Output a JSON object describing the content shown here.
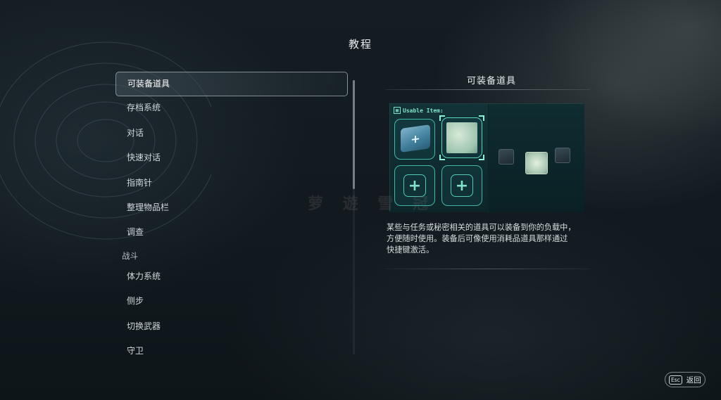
{
  "header": {
    "title": "教程"
  },
  "menu": {
    "items": [
      {
        "label": "可装备道具",
        "selected": true
      },
      {
        "label": "存档系统"
      },
      {
        "label": "对话"
      },
      {
        "label": "快速对话"
      },
      {
        "label": "指南针"
      },
      {
        "label": "整理物品栏"
      },
      {
        "label": "调查"
      }
    ],
    "section": "战斗",
    "section_items": [
      {
        "label": "体力系统"
      },
      {
        "label": "侧步"
      },
      {
        "label": "切换武器"
      },
      {
        "label": "守卫"
      }
    ]
  },
  "detail": {
    "title": "可装备道具",
    "preview_tag": "Usable Item:",
    "description_lines": [
      "某些与任务或秘密相关的道具可以装备到你的负载中，",
      "方便随时使用。装备后可像使用消耗品道具那样通过",
      "快捷键激活。"
    ]
  },
  "footer": {
    "esc_key": "Esc",
    "back_label": "返回"
  },
  "watermark": "萝 遊 雪 冠",
  "colors": {
    "accent": "#3fb8a5",
    "background": "#121a20",
    "text": "#d6dde0"
  }
}
